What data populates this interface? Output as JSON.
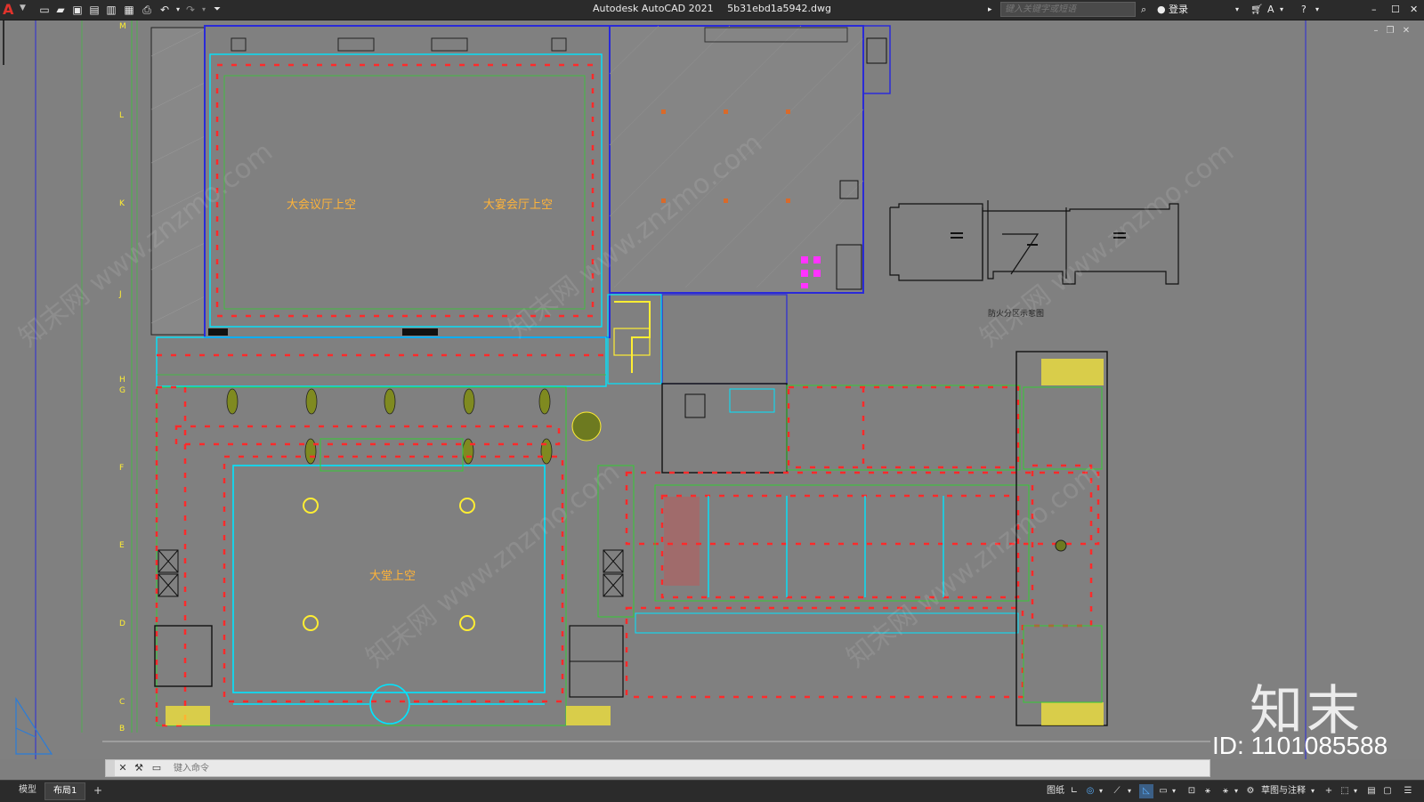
{
  "app": {
    "title": "Autodesk AutoCAD 2021",
    "file_name": "5b31ebd1a5942.dwg",
    "logo_letter": "A"
  },
  "quick_access": {
    "new_icon": "new-file-icon",
    "open_icon": "open-folder-icon",
    "save_icon": "save-icon",
    "save_as_icon": "save-as-icon",
    "print_icon": "print-icon",
    "undo_icon": "undo-icon",
    "redo_icon": "redo-icon"
  },
  "search": {
    "placeholder": "键入关键字或短语"
  },
  "account": {
    "sign_in_label": "登录"
  },
  "drawing": {
    "room_labels": {
      "hall_void_1": "大会议厅上空",
      "hall_void_2": "大宴会厅上空",
      "lobby_void": "大堂上空"
    },
    "grid_labels": [
      "M",
      "L",
      "K",
      "J",
      "H",
      "G",
      "F",
      "E",
      "D",
      "C",
      "B"
    ],
    "fire_zone_caption": "防火分区示意图",
    "colors": {
      "background": "#808080",
      "wall": "#00e5ff",
      "fire_boundary": "#ff2a2a",
      "axis": "#2a2ad8",
      "grid": "#33cc33",
      "stair": "#ffee33",
      "label": "#ffb338"
    }
  },
  "watermark": {
    "site_text": "知末网 www.znzmo.com",
    "logo_text": "知末",
    "id_text": "ID: 1101085588"
  },
  "command_line": {
    "placeholder": "键入命令"
  },
  "layout_tabs": [
    {
      "label": "模型",
      "active": false
    },
    {
      "label": "布局1",
      "active": true
    }
  ],
  "status_bar": {
    "paper_label": "图纸",
    "workspace_label": "草图与注释"
  }
}
